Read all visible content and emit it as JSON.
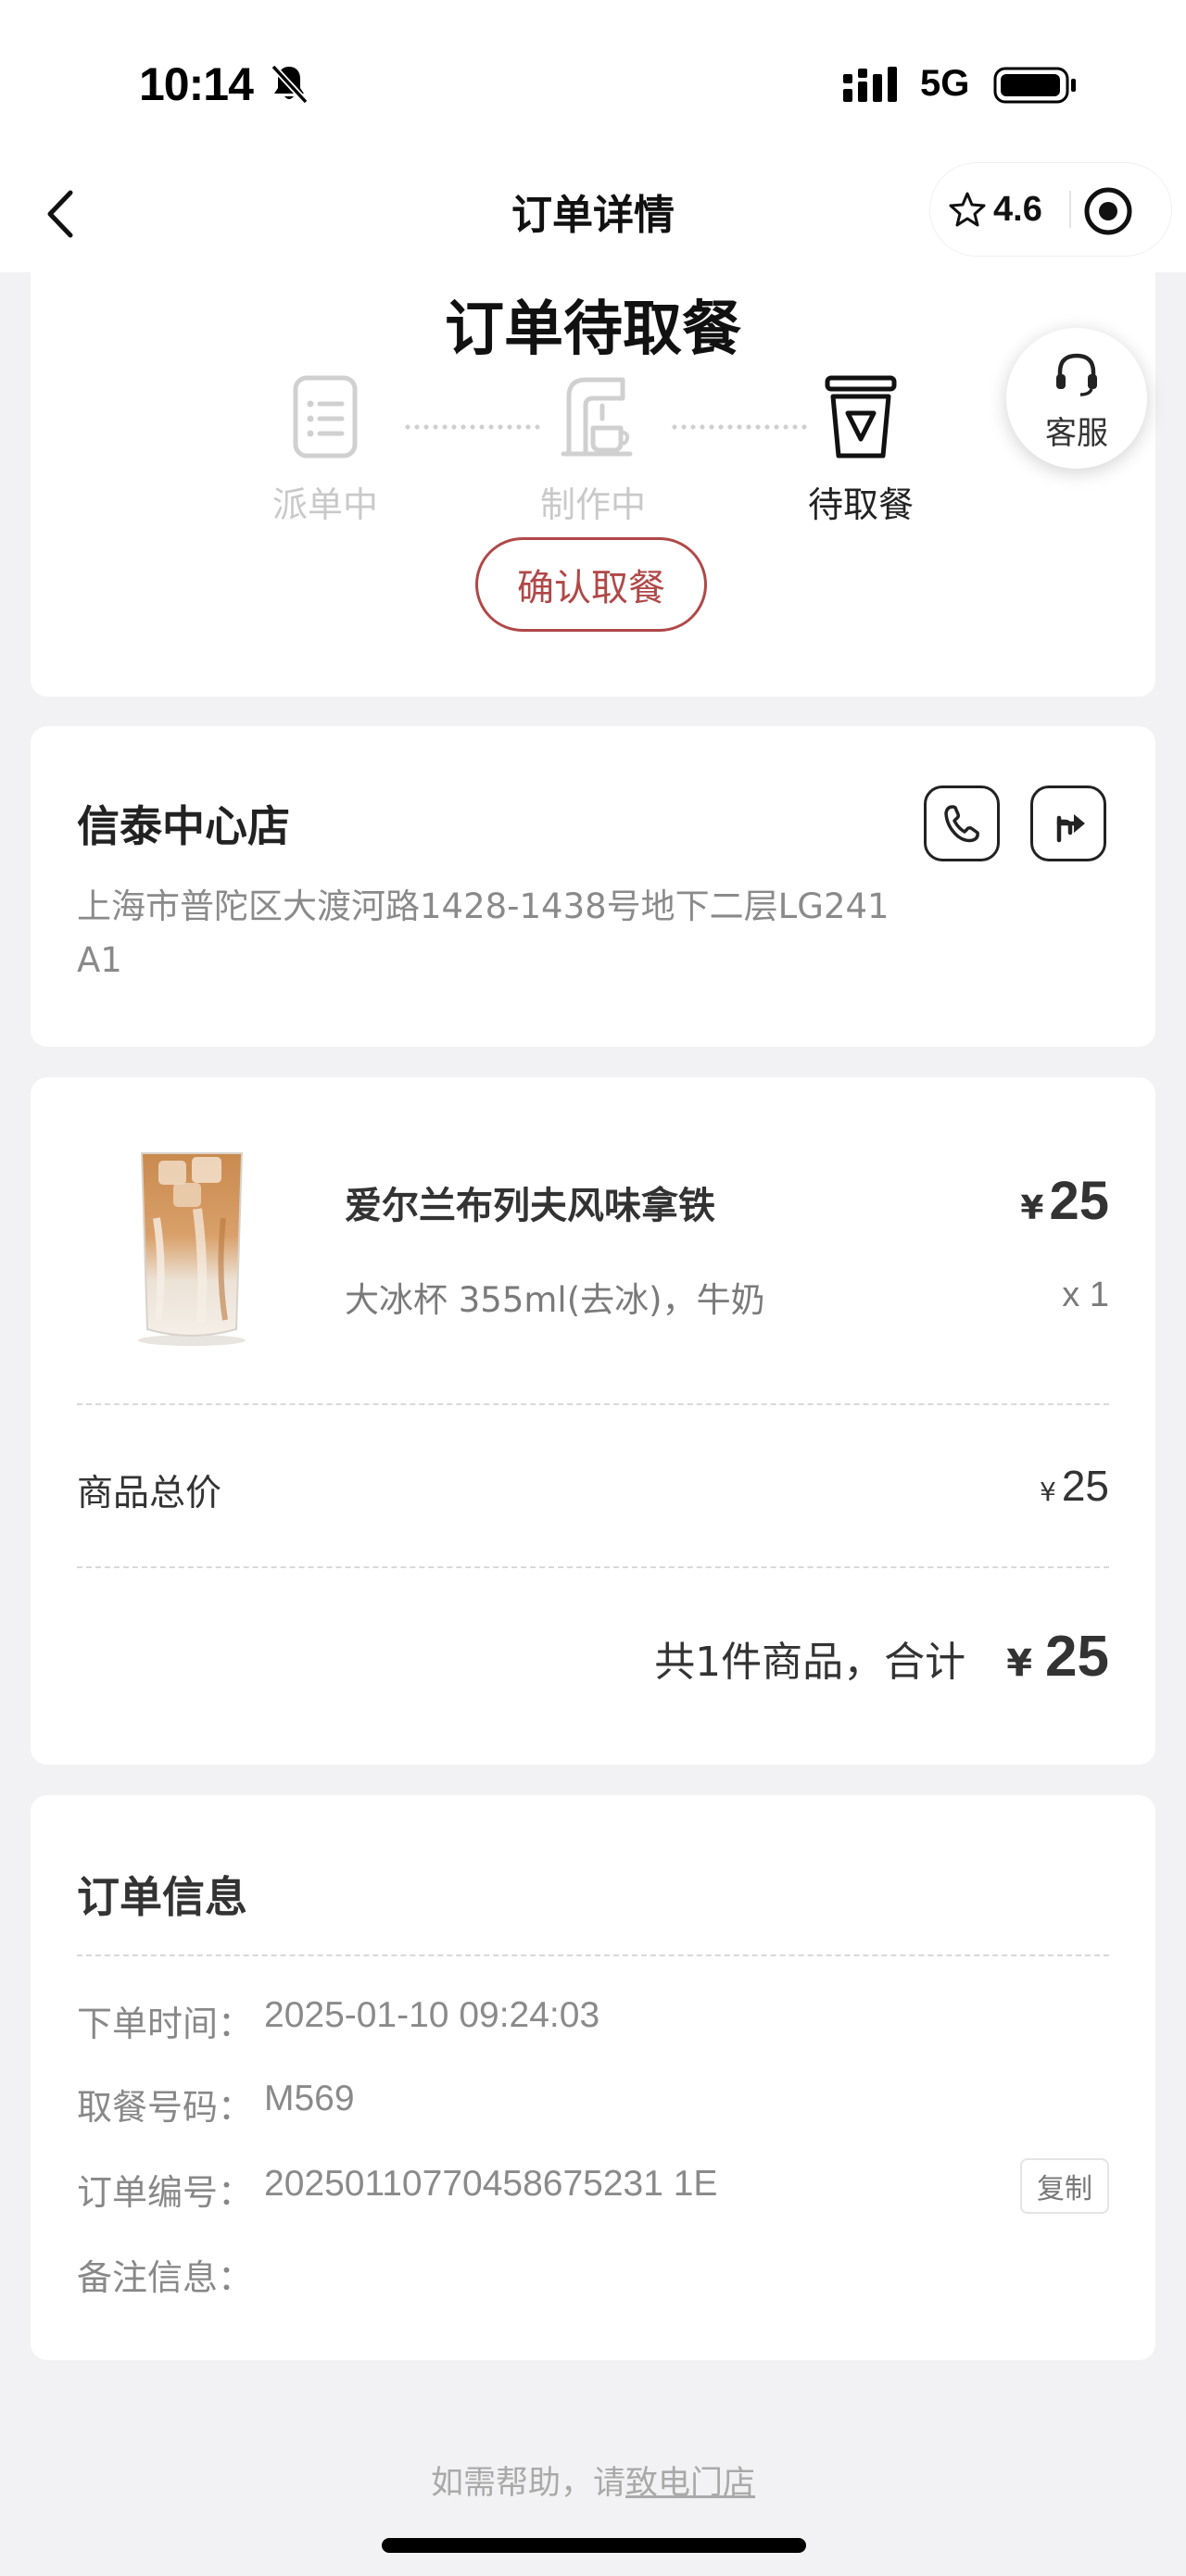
{
  "status_bar": {
    "time": "10:14",
    "network": "5G"
  },
  "nav": {
    "title": "订单详情",
    "rating": "4.6"
  },
  "order_status": {
    "title": "订单待取餐",
    "steps": [
      {
        "label": "派单中",
        "state": "done"
      },
      {
        "label": "制作中",
        "state": "done"
      },
      {
        "label": "待取餐",
        "state": "active"
      }
    ],
    "confirm_label": "确认取餐",
    "service_label": "客服"
  },
  "store": {
    "name": "信泰中心店",
    "address": "上海市普陀区大渡河路1428-1438号地下二层LG241A1"
  },
  "product": {
    "name": "爱尔兰布列夫风味拿铁",
    "spec": "大冰杯 355ml(去冰)，牛奶",
    "currency": "¥",
    "price": "25",
    "quantity": "x 1"
  },
  "summary": {
    "subtotal_label": "商品总价",
    "subtotal_value": "25",
    "total_label": "共1件商品，合计",
    "total_value": "25"
  },
  "order_info": {
    "title": "订单信息",
    "rows": [
      {
        "label": "下单时间：",
        "value": "2025-01-10 09:24:03"
      },
      {
        "label": "取餐号码：",
        "value": "M569"
      },
      {
        "label": "订单编号：",
        "value": "20250110770458675231 1E"
      },
      {
        "label": "备注信息：",
        "value": ""
      }
    ],
    "copy_label": "复制"
  },
  "footer": {
    "help_prefix": "如需帮助，请",
    "help_link": "致电门店"
  },
  "colors": {
    "accent": "#b04848",
    "background": "#f2f2f4",
    "muted_text": "#8a8a8a"
  },
  "icons": [
    "bell-slash-icon",
    "signal-icon",
    "battery-icon",
    "back-arrow-icon",
    "star-icon",
    "target-icon",
    "headset-icon",
    "phone-icon",
    "navigation-icon",
    "order-list-icon",
    "coffee-machine-icon",
    "cup-icon"
  ]
}
